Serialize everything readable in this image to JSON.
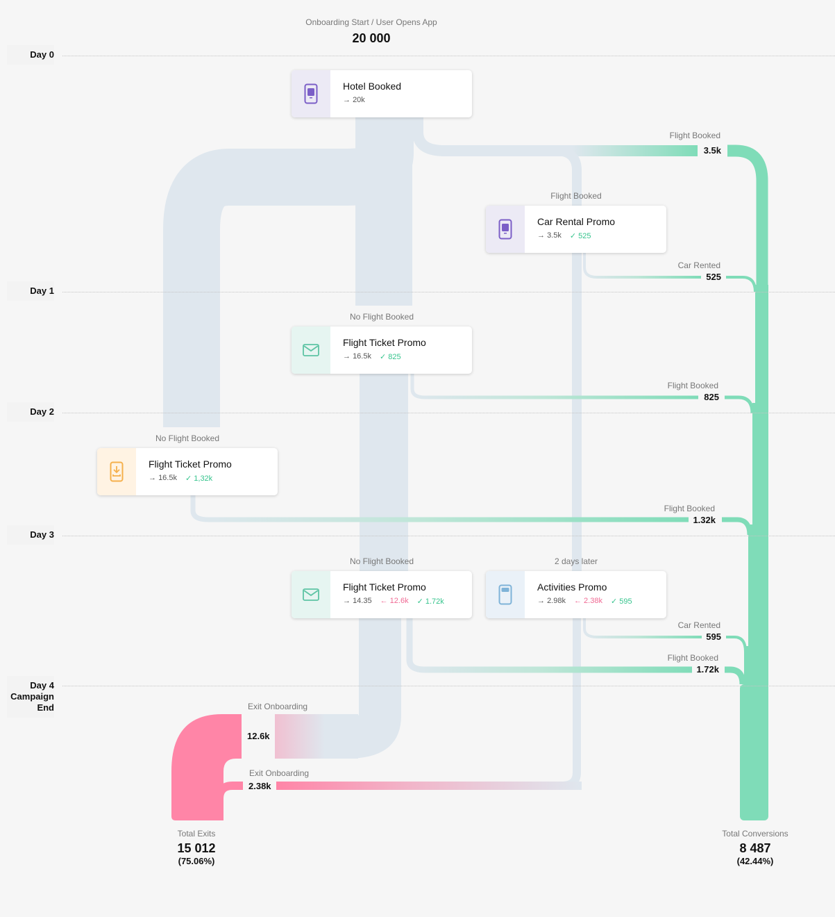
{
  "header": {
    "caption": "Onboarding Start / User Opens App",
    "total": "20 000"
  },
  "days": [
    {
      "label": "Day 0"
    },
    {
      "label": "Day 1"
    },
    {
      "label": "Day 2"
    },
    {
      "label": "Day 3"
    },
    {
      "label": "Day 4\nCampaign\nEnd"
    }
  ],
  "colors": {
    "neutral": "#dfe7ee",
    "conversion": "#7fdcb8",
    "exit": "#ff85a7",
    "background": "#f6f6f6"
  },
  "nodes": [
    {
      "id": "hotel",
      "caption": "",
      "title": "Hotel Booked",
      "in": "20k",
      "exit": null,
      "conv": null,
      "icon": "mobile-app-icon",
      "icon_bg": "#eceaf5",
      "icon_color": "#7b5fc7"
    },
    {
      "id": "car",
      "caption": "Flight Booked",
      "title": "Car Rental Promo",
      "in": "3.5k",
      "exit": null,
      "conv": "525",
      "icon": "mobile-app-icon",
      "icon_bg": "#eceaf5",
      "icon_color": "#7b5fc7"
    },
    {
      "id": "ftp1",
      "caption": "No Flight Booked",
      "title": "Flight Ticket Promo",
      "in": "16.5k",
      "exit": null,
      "conv": "825",
      "icon": "email-icon",
      "icon_bg": "#e6f5f1",
      "icon_color": "#5ec4a4"
    },
    {
      "id": "ftp2",
      "caption": "No Flight Booked",
      "title": "Flight Ticket Promo",
      "in": "16.5k",
      "exit": null,
      "conv": "1,32k",
      "icon": "download-icon",
      "icon_bg": "#fff3e3",
      "icon_color": "#f5b04c"
    },
    {
      "id": "ftp3",
      "caption": "No Flight Booked",
      "title": "Flight Ticket Promo",
      "in": "14.35",
      "exit": "12.6k",
      "conv": "1.72k",
      "icon": "email-icon",
      "icon_bg": "#e6f5f1",
      "icon_color": "#5ec4a4"
    },
    {
      "id": "act",
      "caption": "2 days later",
      "title": "Activities Promo",
      "in": "2.98k",
      "exit": "2.38k",
      "conv": "595",
      "icon": "tablet-icon",
      "icon_bg": "#eaf1f8",
      "icon_color": "#7fb3d8"
    }
  ],
  "conversion_labels": [
    {
      "caption": "Flight Booked",
      "value": "3.5k"
    },
    {
      "caption": "Car Rented",
      "value": "525"
    },
    {
      "caption": "Flight Booked",
      "value": "825"
    },
    {
      "caption": "Flight Booked",
      "value": "1.32k"
    },
    {
      "caption": "Car Rented",
      "value": "595"
    },
    {
      "caption": "Flight Booked",
      "value": "1.72k"
    }
  ],
  "exit_labels": [
    {
      "caption": "Exit Onboarding",
      "value": "12.6k"
    },
    {
      "caption": "Exit Onboarding",
      "value": "2.38k"
    }
  ],
  "totals": {
    "exits": {
      "label": "Total Exits",
      "value": "15 012",
      "pct": "(75.06%)"
    },
    "conversions": {
      "label": "Total Conversions",
      "value": "8 487",
      "pct": "(42.44%)"
    }
  }
}
